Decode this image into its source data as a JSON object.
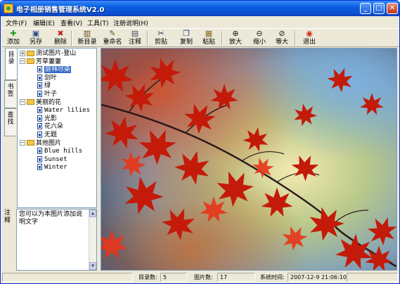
{
  "window": {
    "title": "电子相册销售管理系统V2.0",
    "controls": {
      "minimize": "_",
      "maximize": "□",
      "close": "✕"
    }
  },
  "menu": [
    "文件(F)",
    "编辑(E)",
    "查看(V)",
    "工具(T)",
    "注册说明(H)"
  ],
  "toolbar": [
    {
      "label": "添加",
      "icon": "add-icon",
      "glyph": "✚",
      "color": "#2a9a2a"
    },
    {
      "label": "另存",
      "icon": "save-icon",
      "glyph": "▣",
      "color": "#2a4a8a"
    },
    {
      "label": "删除",
      "icon": "delete-icon",
      "glyph": "✖",
      "color": "#c0201a"
    },
    {
      "label": "新目录",
      "icon": "new-folder-icon",
      "glyph": "▥",
      "color": "#6a4a1a"
    },
    {
      "label": "重命名",
      "icon": "rename-icon",
      "glyph": "✎",
      "color": "#5a5a1a"
    },
    {
      "label": "注释",
      "icon": "note-icon",
      "glyph": "▤",
      "color": "#4a4a6a"
    },
    {
      "label": "剪贴",
      "icon": "cut-icon",
      "glyph": "✂",
      "color": "#2a2a6a"
    },
    {
      "label": "复制",
      "icon": "copy-icon",
      "glyph": "❐",
      "color": "#2a4a8a"
    },
    {
      "label": "粘贴",
      "icon": "paste-icon",
      "glyph": "▦",
      "color": "#8a6a2a"
    },
    {
      "label": "放大",
      "icon": "zoom-in-icon",
      "glyph": "⊕",
      "color": "#1a1a1a"
    },
    {
      "label": "缩小",
      "icon": "zoom-out-icon",
      "glyph": "⊖",
      "color": "#1a1a1a"
    },
    {
      "label": "等大",
      "icon": "actual-size-icon",
      "glyph": "⊘",
      "color": "#1a1a1a"
    },
    {
      "label": "退出",
      "icon": "exit-icon",
      "glyph": "◉",
      "color": "#d02a1a"
    }
  ],
  "side_tabs": [
    "目录",
    "书签",
    "查找"
  ],
  "tree": [
    {
      "type": "folder",
      "label": "测试图片-登山",
      "expander": "+",
      "level": 0
    },
    {
      "type": "folder",
      "label": "芳草萋萋",
      "expander": "−",
      "level": 0
    },
    {
      "type": "file",
      "label": "层林尽染",
      "level": 1,
      "selected": true
    },
    {
      "type": "file",
      "label": "剑叶",
      "level": 1
    },
    {
      "type": "file",
      "label": "绿",
      "level": 1
    },
    {
      "type": "file",
      "label": "叶子",
      "level": 1
    },
    {
      "type": "folder",
      "label": "美丽的花",
      "expander": "−",
      "level": 0
    },
    {
      "type": "file",
      "label": "Water lilies",
      "level": 1
    },
    {
      "type": "file",
      "label": "光影",
      "level": 1
    },
    {
      "type": "file",
      "label": "花六朵",
      "level": 1
    },
    {
      "type": "file",
      "label": "无题",
      "level": 1
    },
    {
      "type": "folder",
      "label": "其他图片",
      "expander": "−",
      "level": 0
    },
    {
      "type": "file",
      "label": "Blue hills",
      "level": 1
    },
    {
      "type": "file",
      "label": "Sunset",
      "level": 1
    },
    {
      "type": "file",
      "label": "Winter",
      "level": 1
    }
  ],
  "note": {
    "label": "注释",
    "text": "您可以为本图片添加说明文字"
  },
  "status": {
    "dir_label": "目录数:",
    "dir_value": "5",
    "pic_label": "图片数:",
    "pic_value": "17",
    "time_label": "系统时间:",
    "time_value": "2007-12-9 21:06:10"
  }
}
